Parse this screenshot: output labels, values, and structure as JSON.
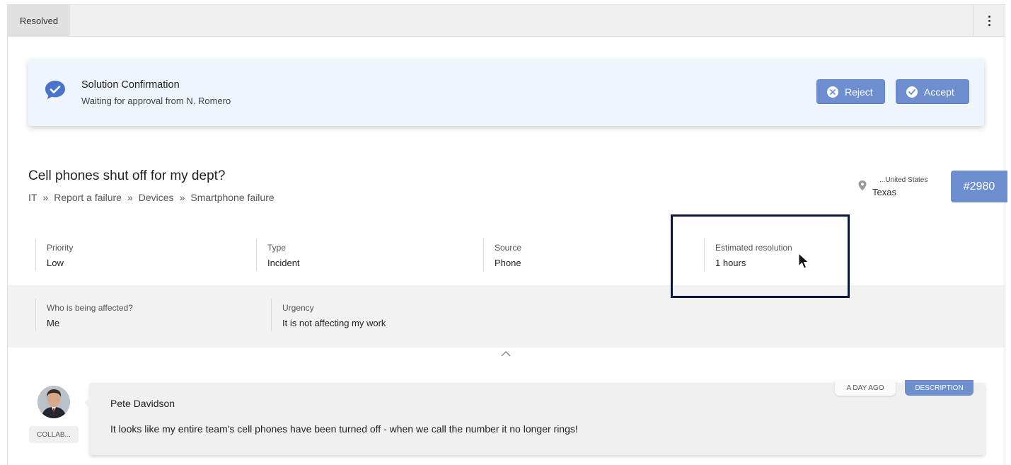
{
  "topbar": {
    "status_tab": "Resolved",
    "menu_icon": "kebab-menu-icon"
  },
  "confirmation": {
    "icon": "chat-check-icon",
    "title": "Solution Confirmation",
    "subtitle": "Waiting for approval from N. Romero",
    "reject_label": "Reject",
    "accept_label": "Accept",
    "button_color": "#6d8fcf"
  },
  "ticket": {
    "title": "Cell phones shut off for my dept?",
    "breadcrumb": [
      "IT",
      "Report a failure",
      "Devices",
      "Smartphone failure"
    ],
    "breadcrumb_separator": "»",
    "location_country": "...United States",
    "location_state": "Texas",
    "id": "#2980"
  },
  "fields": [
    {
      "label": "Priority",
      "value": "Low"
    },
    {
      "label": "Type",
      "value": "Incident"
    },
    {
      "label": "Source",
      "value": "Phone"
    },
    {
      "label": "Estimated resolution",
      "value": "1 hours"
    }
  ],
  "extra_fields": [
    {
      "label": "Who is being affected?",
      "value": "Me"
    },
    {
      "label": "Urgency",
      "value": "It is not affecting my work"
    }
  ],
  "comment": {
    "author": "Pete Davidson",
    "role_badge": "COLLAB...",
    "time": "A DAY AGO",
    "tag": "DESCRIPTION",
    "text": "It looks like my entire team's cell phones have been turned off - when we call the number it no longer rings!"
  },
  "colors": {
    "accent": "#6d8fcf",
    "highlight_border": "#0e1640",
    "card_bg": "#eef5fd"
  }
}
